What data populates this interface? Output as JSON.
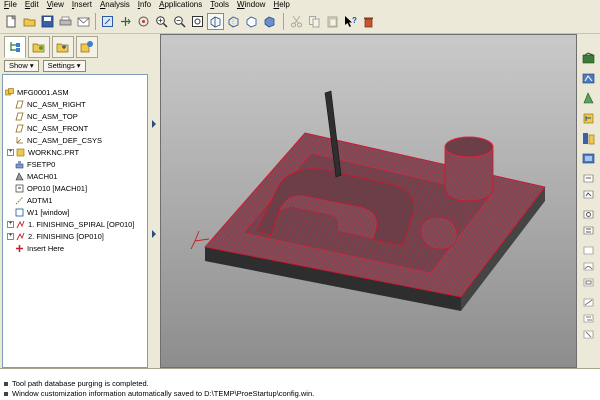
{
  "menubar": {
    "items": [
      "File",
      "Edit",
      "View",
      "Insert",
      "Analysis",
      "Info",
      "Applications",
      "Tools",
      "Window",
      "Help"
    ]
  },
  "toolbar": {
    "icons": [
      "new-file-icon",
      "open-file-icon",
      "save-icon",
      "print-icon",
      "email-icon",
      "repaint-icon",
      "spin-center-icon",
      "orient-icon",
      "zoom-in-icon",
      "zoom-out-icon",
      "refit-icon",
      "wireframe-icon",
      "hidden-line-icon",
      "no-hidden-icon",
      "shading-icon",
      "cut-icon",
      "copy-icon",
      "paste-icon",
      "whats-this-icon",
      "trash-icon"
    ]
  },
  "navigator": {
    "tabs": [
      "model-tree-icon",
      "folder-browser-icon",
      "favorites-icon",
      "connections-icon"
    ],
    "show_label": "Show ▾",
    "settings_label": "Settings ▾"
  },
  "tree": {
    "items": [
      {
        "label": "MFG0001.ASM",
        "icon": "assembly-icon",
        "indent": 0
      },
      {
        "label": "NC_ASM_RIGHT",
        "icon": "datum-plane-icon",
        "indent": 1
      },
      {
        "label": "NC_ASM_TOP",
        "icon": "datum-plane-icon",
        "indent": 1
      },
      {
        "label": "NC_ASM_FRONT",
        "icon": "datum-plane-icon",
        "indent": 1
      },
      {
        "label": "NC_ASM_DEF_CSYS",
        "icon": "csys-icon",
        "indent": 1
      },
      {
        "label": "WORKNC.PRT",
        "icon": "part-icon",
        "indent": 1,
        "expandable": true
      },
      {
        "label": "FSETP0",
        "icon": "fixture-icon",
        "indent": 1
      },
      {
        "label": "MACH01",
        "icon": "machine-icon",
        "indent": 1
      },
      {
        "label": "OP010 [MACH01]",
        "icon": "operation-icon",
        "indent": 1
      },
      {
        "label": "ADTM1",
        "icon": "datum-axis-icon",
        "indent": 1
      },
      {
        "label": "W1 [window]",
        "icon": "window-icon",
        "indent": 1
      },
      {
        "label": "1. FINISHING_SPIRAL [OP010]",
        "icon": "toolpath-icon",
        "indent": 1,
        "expandable": true
      },
      {
        "label": "2. FINISHING [OP010]",
        "icon": "toolpath-icon",
        "indent": 1,
        "expandable": true
      },
      {
        "label": "Insert Here",
        "icon": "insert-here-icon",
        "indent": 1
      }
    ]
  },
  "righttoolbar": {
    "icons": [
      "mfg-model-icon",
      "mfg-setup-icon",
      "refine-icon",
      "workcell-icon",
      "tool-path-icon",
      "play-path-icon",
      "nc-check-icon",
      "gouge-check-icon",
      "material-removal-icon",
      "sequence-info-icon",
      "mill-volume-icon",
      "mill-surface-icon",
      "mill-window-icon",
      "sketch-icon",
      "offset-icon",
      "trim-icon"
    ]
  },
  "status": {
    "messages": [
      "Tool path database purging is completed.",
      "Window customization information automatically saved to D:\\TEMP\\ProeStartup\\config.win."
    ]
  },
  "colors": {
    "toolpath": "#d8102a",
    "part_surface": "#7a4f59",
    "background_top": "#c9c9c9",
    "background_bottom": "#8d8d8d",
    "chrome": "#ece9d8"
  }
}
